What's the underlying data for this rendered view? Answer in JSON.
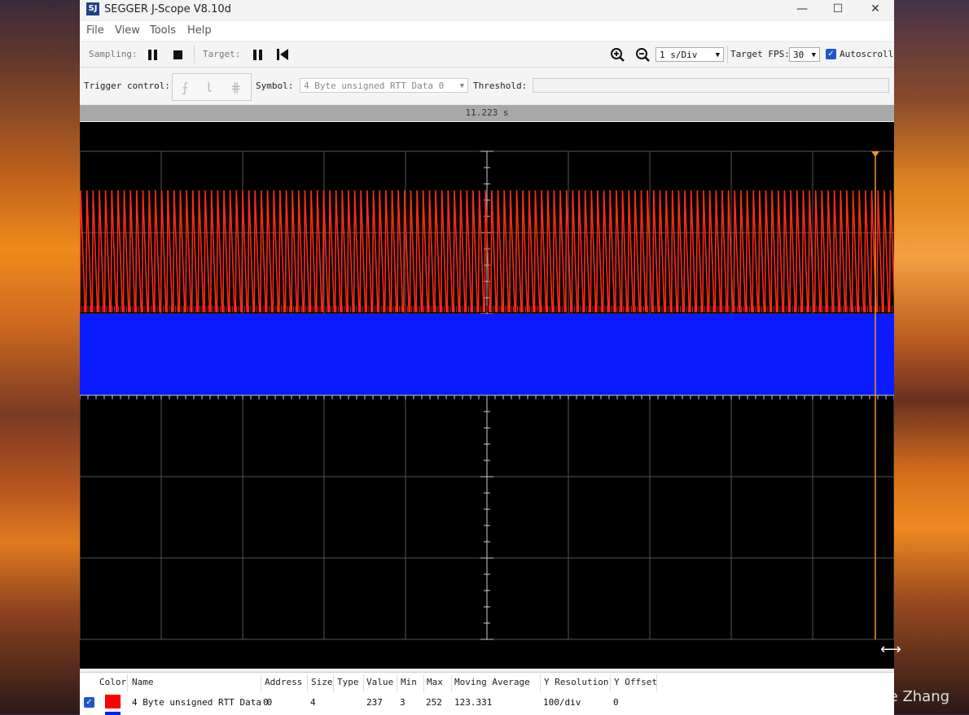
{
  "window": {
    "title": "SEGGER J-Scope V8.10d",
    "minimize": "—",
    "maximize": "☐",
    "close": "✕"
  },
  "menu": [
    "File",
    "View",
    "Tools",
    "Help"
  ],
  "toolbar": {
    "sampling_label": "Sampling:",
    "target_label": "Target:",
    "time_div": "1 s/Div",
    "fps_label": "Target FPS:",
    "fps_value": "30",
    "autoscroll_label": "Autoscroll",
    "autoscroll_checked": true
  },
  "trigger": {
    "control_label": "Trigger control:",
    "symbol_label": "Symbol:",
    "symbol_value": "4 Byte unsigned RTT Data 0",
    "threshold_label": "Threshold:",
    "threshold_value": ""
  },
  "timebar": {
    "time": "11.223 s"
  },
  "colors": {
    "series1": "#ff2a1a",
    "series2": "#0a1cff",
    "cursor": "#f5922a"
  },
  "table": {
    "headers": [
      "Color",
      "Name",
      "Address",
      "Size",
      "Type",
      "Value",
      "Min",
      "Max",
      "Moving Average",
      "Y Resolution",
      "Y Offset"
    ],
    "rows": [
      {
        "checked": true,
        "color": "#ff0000",
        "name": "4 Byte unsigned RTT Data 0",
        "address": "0",
        "size": "4",
        "type": "",
        "value": "237",
        "min": "3",
        "max": "252",
        "moving_average": "123.331",
        "y_resolution": "100/div",
        "y_offset": "0"
      }
    ]
  },
  "watermark": "CSDN @Wallace Zhang"
}
